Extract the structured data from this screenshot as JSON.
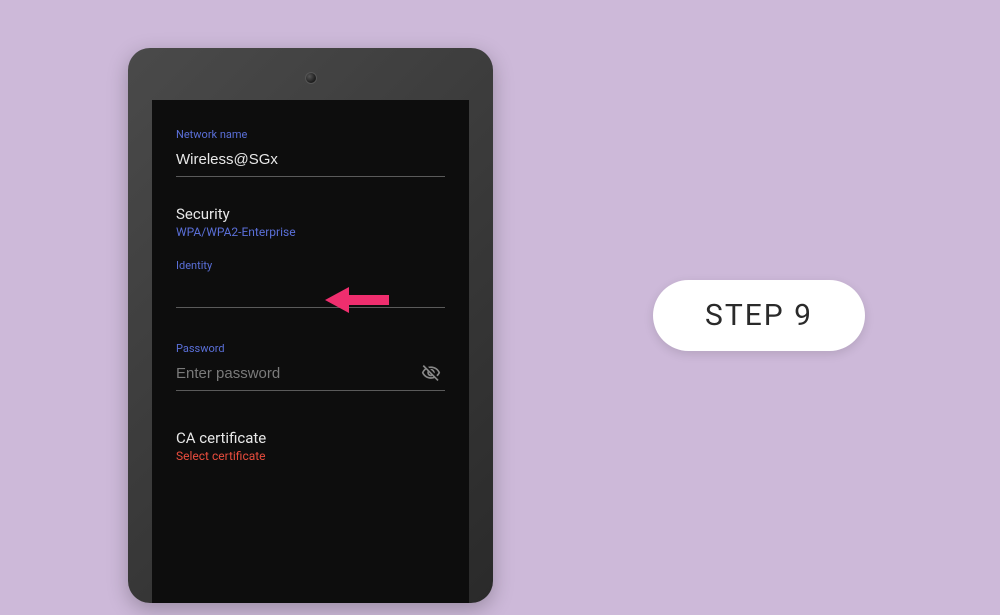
{
  "step_label": "STEP 9",
  "network": {
    "label": "Network name",
    "value": "Wireless@SGx"
  },
  "security": {
    "title": "Security",
    "value": "WPA/WPA2-Enterprise"
  },
  "identity": {
    "label": "Identity",
    "value": ""
  },
  "password": {
    "label": "Password",
    "placeholder": "Enter password",
    "value": ""
  },
  "certificate": {
    "title": "CA certificate",
    "value": "Select certificate"
  },
  "colors": {
    "accent_blue": "#5a6fd8",
    "accent_red": "#e84c3d",
    "arrow": "#ef2e6e"
  }
}
